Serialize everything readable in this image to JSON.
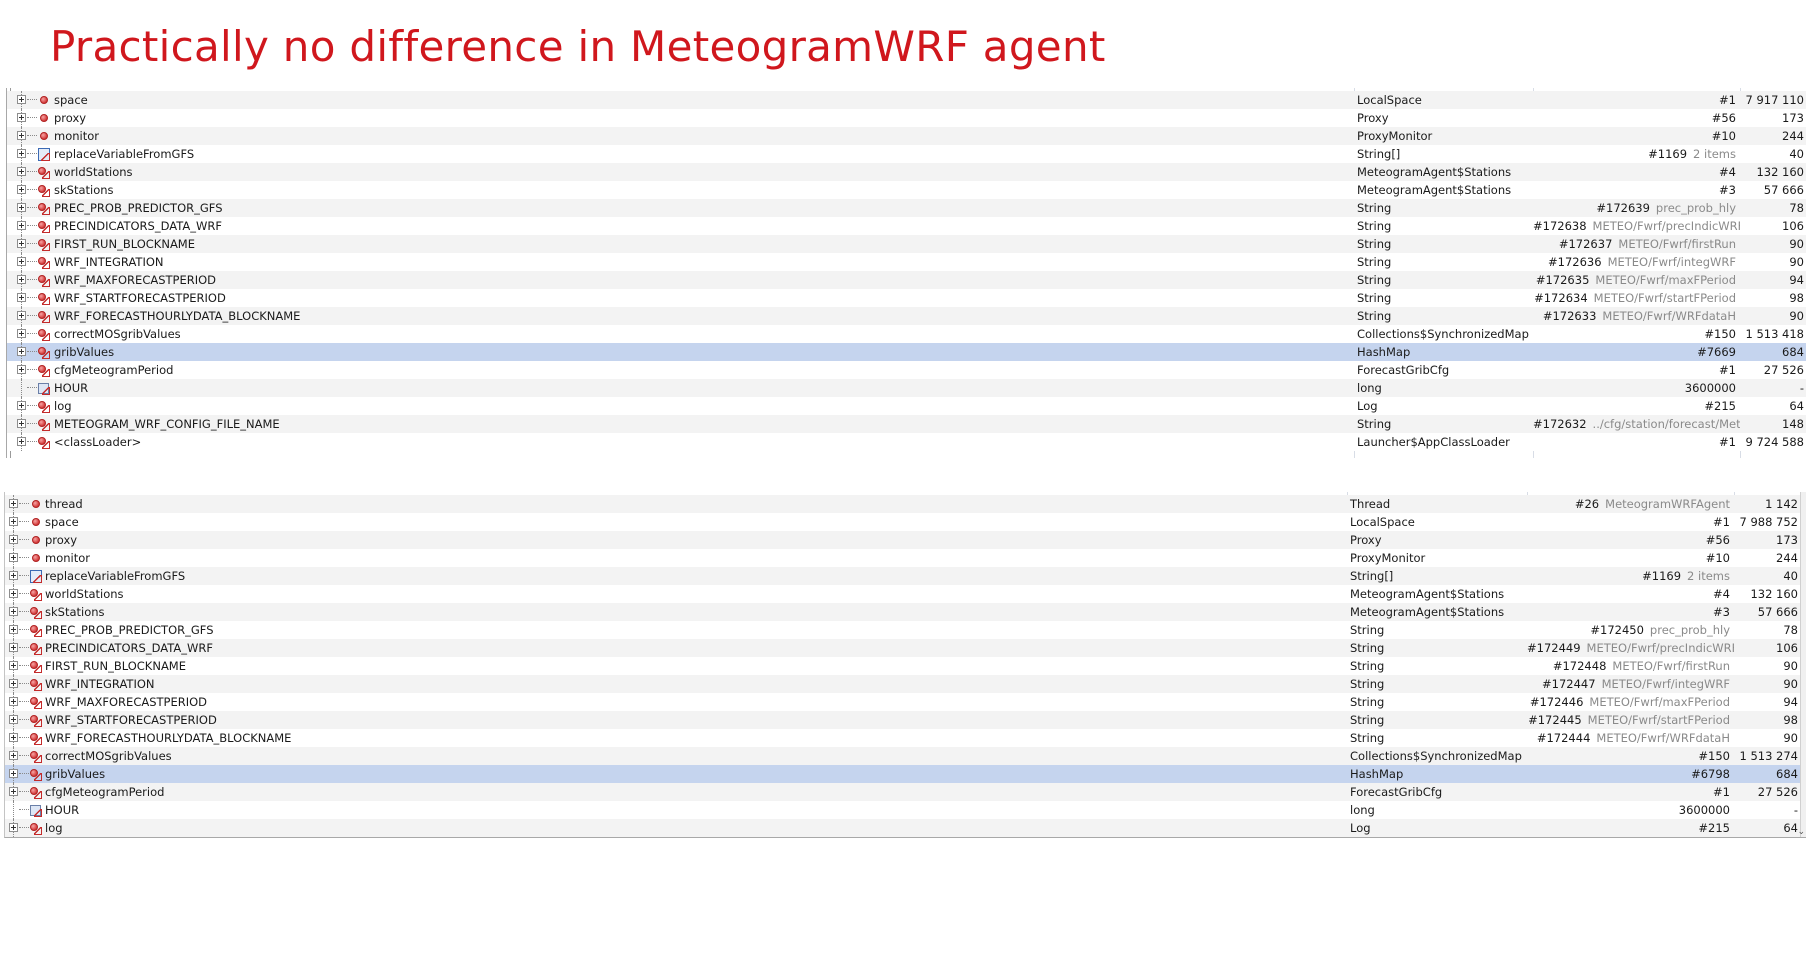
{
  "title": "Practically no difference in MeteogramWRF agent",
  "panels": [
    {
      "id": "panel1",
      "rows": [
        {
          "name": "space",
          "icon": "instance-field-icon",
          "type": "LocalSpace",
          "ref": "#1",
          "ref_extra": "",
          "size": "7 917 110"
        },
        {
          "name": "proxy",
          "icon": "instance-field-icon",
          "type": "Proxy",
          "ref": "#56",
          "ref_extra": "",
          "size": "173"
        },
        {
          "name": "monitor",
          "icon": "instance-field-icon",
          "type": "ProxyMonitor",
          "ref": "#10",
          "ref_extra": "",
          "size": "244"
        },
        {
          "name": "replaceVariableFromGFS",
          "icon": "static-array-field-icon",
          "type": "String[]",
          "ref": "#1169",
          "ref_extra": "2 items",
          "size": "40"
        },
        {
          "name": "worldStations",
          "icon": "static-field-icon",
          "type": "MeteogramAgent$Stations",
          "ref": "#4",
          "ref_extra": "",
          "size": "132 160"
        },
        {
          "name": "skStations",
          "icon": "static-field-icon",
          "type": "MeteogramAgent$Stations",
          "ref": "#3",
          "ref_extra": "",
          "size": "57 666"
        },
        {
          "name": "PREC_PROB_PREDICTOR_GFS",
          "icon": "static-field-icon",
          "type": "String",
          "ref": "#172639",
          "ref_extra": "prec_prob_hly",
          "size": "78"
        },
        {
          "name": "PRECINDICATORS_DATA_WRF",
          "icon": "static-field-icon",
          "type": "String",
          "ref": "#172638",
          "ref_extra": "METEO/Fwrf/precIndicWRF…",
          "size": "106"
        },
        {
          "name": "FIRST_RUN_BLOCKNAME",
          "icon": "static-field-icon",
          "type": "String",
          "ref": "#172637",
          "ref_extra": "METEO/Fwrf/firstRun",
          "size": "90"
        },
        {
          "name": "WRF_INTEGRATION",
          "icon": "static-field-icon",
          "type": "String",
          "ref": "#172636",
          "ref_extra": "METEO/Fwrf/integWRF",
          "size": "90"
        },
        {
          "name": "WRF_MAXFORECASTPERIOD",
          "icon": "static-field-icon",
          "type": "String",
          "ref": "#172635",
          "ref_extra": "METEO/Fwrf/maxFPeriod",
          "size": "94"
        },
        {
          "name": "WRF_STARTFORECASTPERIOD",
          "icon": "static-field-icon",
          "type": "String",
          "ref": "#172634",
          "ref_extra": "METEO/Fwrf/startFPeriod",
          "size": "98"
        },
        {
          "name": "WRF_FORECASTHOURLYDATA_BLOCKNAME",
          "icon": "static-field-icon",
          "type": "String",
          "ref": "#172633",
          "ref_extra": "METEO/Fwrf/WRFdataH",
          "size": "90"
        },
        {
          "name": "correctMOSgribValues",
          "icon": "static-field-icon",
          "type": "Collections$SynchronizedMap",
          "ref": "#150",
          "ref_extra": "",
          "size": "1 513 418"
        },
        {
          "name": "gribValues",
          "icon": "static-field-icon",
          "type": "HashMap",
          "ref": "#7669",
          "ref_extra": "",
          "size": "684",
          "selected": true
        },
        {
          "name": "cfgMeteogramPeriod",
          "icon": "static-field-icon",
          "type": "ForecastGribCfg",
          "ref": "#1",
          "ref_extra": "",
          "size": "27 526"
        },
        {
          "name": "HOUR",
          "icon": "static-primitive-field-icon",
          "type": "long",
          "ref": "3600000",
          "ref_extra": "",
          "size": "-",
          "leaf": true
        },
        {
          "name": "log",
          "icon": "static-field-icon",
          "type": "Log",
          "ref": "#215",
          "ref_extra": "",
          "size": "64"
        },
        {
          "name": "METEOGRAM_WRF_CONFIG_FILE_NAME",
          "icon": "static-field-icon",
          "type": "String",
          "ref": "#172632",
          "ref_extra": "../cfg/station/forecast/Met…",
          "size": "148"
        },
        {
          "name": "<classLoader>",
          "icon": "static-field-icon",
          "type": "Launcher$AppClassLoader",
          "ref": "#1",
          "ref_extra": "",
          "size": "9 724 588"
        }
      ]
    },
    {
      "id": "panel2",
      "rows": [
        {
          "name": "thread",
          "icon": "instance-field-icon",
          "type": "Thread",
          "ref": "#26",
          "ref_extra": "MeteogramWRFAgent",
          "size": "1 142"
        },
        {
          "name": "space",
          "icon": "instance-field-icon",
          "type": "LocalSpace",
          "ref": "#1",
          "ref_extra": "",
          "size": "7 988 752"
        },
        {
          "name": "proxy",
          "icon": "instance-field-icon",
          "type": "Proxy",
          "ref": "#56",
          "ref_extra": "",
          "size": "173"
        },
        {
          "name": "monitor",
          "icon": "instance-field-icon",
          "type": "ProxyMonitor",
          "ref": "#10",
          "ref_extra": "",
          "size": "244"
        },
        {
          "name": "replaceVariableFromGFS",
          "icon": "static-array-field-icon",
          "type": "String[]",
          "ref": "#1169",
          "ref_extra": "2 items",
          "size": "40"
        },
        {
          "name": "worldStations",
          "icon": "static-field-icon",
          "type": "MeteogramAgent$Stations",
          "ref": "#4",
          "ref_extra": "",
          "size": "132 160"
        },
        {
          "name": "skStations",
          "icon": "static-field-icon",
          "type": "MeteogramAgent$Stations",
          "ref": "#3",
          "ref_extra": "",
          "size": "57 666"
        },
        {
          "name": "PREC_PROB_PREDICTOR_GFS",
          "icon": "static-field-icon",
          "type": "String",
          "ref": "#172450",
          "ref_extra": "prec_prob_hly",
          "size": "78"
        },
        {
          "name": "PRECINDICATORS_DATA_WRF",
          "icon": "static-field-icon",
          "type": "String",
          "ref": "#172449",
          "ref_extra": "METEO/Fwrf/precIndicWRF…",
          "size": "106"
        },
        {
          "name": "FIRST_RUN_BLOCKNAME",
          "icon": "static-field-icon",
          "type": "String",
          "ref": "#172448",
          "ref_extra": "METEO/Fwrf/firstRun",
          "size": "90"
        },
        {
          "name": "WRF_INTEGRATION",
          "icon": "static-field-icon",
          "type": "String",
          "ref": "#172447",
          "ref_extra": "METEO/Fwrf/integWRF",
          "size": "90"
        },
        {
          "name": "WRF_MAXFORECASTPERIOD",
          "icon": "static-field-icon",
          "type": "String",
          "ref": "#172446",
          "ref_extra": "METEO/Fwrf/maxFPeriod",
          "size": "94"
        },
        {
          "name": "WRF_STARTFORECASTPERIOD",
          "icon": "static-field-icon",
          "type": "String",
          "ref": "#172445",
          "ref_extra": "METEO/Fwrf/startFPeriod",
          "size": "98"
        },
        {
          "name": "WRF_FORECASTHOURLYDATA_BLOCKNAME",
          "icon": "static-field-icon",
          "type": "String",
          "ref": "#172444",
          "ref_extra": "METEO/Fwrf/WRFdataH",
          "size": "90"
        },
        {
          "name": "correctMOSgribValues",
          "icon": "static-field-icon",
          "type": "Collections$SynchronizedMap",
          "ref": "#150",
          "ref_extra": "",
          "size": "1 513 274"
        },
        {
          "name": "gribValues",
          "icon": "static-field-icon",
          "type": "HashMap",
          "ref": "#6798",
          "ref_extra": "",
          "size": "684",
          "selected": true
        },
        {
          "name": "cfgMeteogramPeriod",
          "icon": "static-field-icon",
          "type": "ForecastGribCfg",
          "ref": "#1",
          "ref_extra": "",
          "size": "27 526"
        },
        {
          "name": "HOUR",
          "icon": "static-primitive-field-icon",
          "type": "long",
          "ref": "3600000",
          "ref_extra": "",
          "size": "-",
          "leaf": true
        },
        {
          "name": "log",
          "icon": "static-field-icon",
          "type": "Log",
          "ref": "#215",
          "ref_extra": "",
          "size": "64"
        }
      ]
    }
  ]
}
